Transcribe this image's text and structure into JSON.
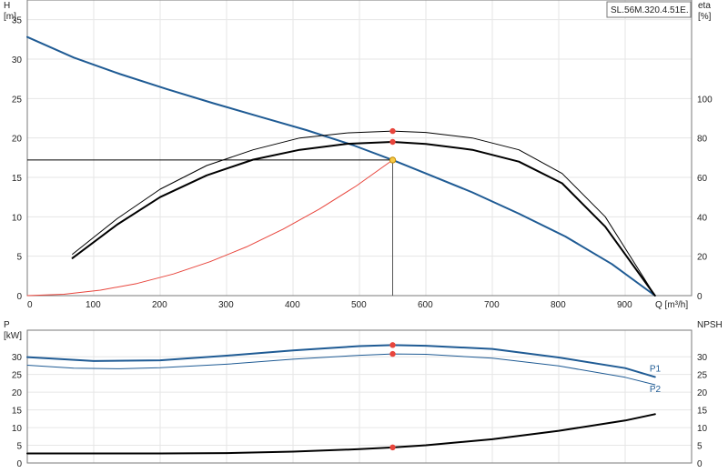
{
  "colors": {
    "head": "#1f5b94",
    "eta": "#000000",
    "power": "#1f5b94",
    "npsh": "#000000",
    "system": "#e8453c",
    "marker": "#e8453c",
    "op_marker": "#f7c948",
    "grid": "#e6e6e6"
  },
  "chart_data": [
    {
      "type": "line",
      "title": "SL.56M.320.4.51E.",
      "xlabel": "Q [m³/h]",
      "ylabel_left": "H\n[m]",
      "ylabel_right": "eta\n[%]",
      "xlim": [
        0,
        1000
      ],
      "x_ticks": [
        0,
        100,
        200,
        300,
        400,
        500,
        600,
        700,
        800,
        900
      ],
      "ylim_left": [
        0,
        37.5
      ],
      "y_ticks_left": [
        0,
        5,
        10,
        15,
        20,
        25,
        30,
        35
      ],
      "ylim_right": [
        0,
        150
      ],
      "y_ticks_right": [
        0,
        20,
        40,
        60,
        80,
        100
      ],
      "grid": true,
      "series": [
        {
          "key": "head",
          "axis": "left",
          "width": 2,
          "x": [
            0,
            70,
            140,
            210,
            280,
            350,
            420,
            490,
            550,
            600,
            670,
            740,
            810,
            880,
            945
          ],
          "y": [
            32.8,
            30.2,
            28.1,
            26.2,
            24.4,
            22.7,
            21.0,
            19.1,
            17.2,
            15.5,
            13.1,
            10.4,
            7.5,
            4.0,
            0.0
          ]
        },
        {
          "key": "eta",
          "axis": "right",
          "width": 2,
          "x": [
            68,
            135,
            200,
            270,
            340,
            410,
            480,
            550,
            600,
            670,
            740,
            805,
            870,
            945
          ],
          "y": [
            19,
            36,
            50,
            61,
            69,
            74,
            77,
            78,
            77,
            74,
            68,
            57,
            35,
            0
          ]
        },
        {
          "key": "eta",
          "axis": "right",
          "width": 1,
          "x": [
            68,
            135,
            200,
            270,
            340,
            410,
            480,
            550,
            600,
            670,
            740,
            805,
            870,
            945
          ],
          "y": [
            21,
            39,
            54,
            66,
            74,
            80,
            82.5,
            83.5,
            82.8,
            80,
            74,
            62,
            40,
            0
          ]
        },
        {
          "key": "system",
          "axis": "left",
          "width": 1,
          "x": [
            0,
            55,
            110,
            165,
            220,
            275,
            330,
            385,
            440,
            495,
            550
          ],
          "y": [
            0,
            0.17,
            0.69,
            1.54,
            2.75,
            4.3,
            6.19,
            8.43,
            11.0,
            13.9,
            17.2
          ]
        }
      ],
      "markers": [
        {
          "x": 550,
          "y": 83.5,
          "axis": "right",
          "key": "marker"
        },
        {
          "x": 550,
          "y": 78,
          "axis": "right",
          "key": "marker"
        },
        {
          "x": 550,
          "y": 17.2,
          "axis": "left",
          "key": "op_marker"
        }
      ],
      "duty_point": {
        "x": 550,
        "y": 17.2
      }
    },
    {
      "type": "line",
      "xlabel": "",
      "ylabel_left": "P\n[kW]",
      "ylabel_right": "NPSH\n[m]",
      "xlim": [
        0,
        1000
      ],
      "x_ticks": [
        0,
        100,
        200,
        300,
        400,
        500,
        600,
        700,
        800,
        900
      ],
      "ylim_left": [
        0,
        37.5
      ],
      "y_ticks_left": [
        0,
        5,
        10,
        15,
        20,
        25,
        30
      ],
      "ylim_right": [
        0,
        37.5
      ],
      "y_ticks_right": [
        0,
        5,
        10,
        15,
        20,
        25,
        30
      ],
      "grid": true,
      "series": [
        {
          "name": "P1",
          "key": "power",
          "axis": "left",
          "width": 2,
          "x": [
            0,
            100,
            200,
            300,
            400,
            500,
            550,
            600,
            700,
            800,
            900,
            945
          ],
          "y": [
            29.9,
            28.8,
            29.0,
            30.3,
            31.8,
            33.0,
            33.3,
            33.1,
            32.2,
            29.8,
            26.8,
            24.3
          ]
        },
        {
          "name": "P2",
          "key": "power",
          "axis": "left",
          "width": 1,
          "x": [
            0,
            70,
            140,
            200,
            300,
            400,
            500,
            550,
            600,
            700,
            800,
            900,
            945
          ],
          "y": [
            27.6,
            26.8,
            26.6,
            26.9,
            27.9,
            29.3,
            30.4,
            30.8,
            30.7,
            29.6,
            27.4,
            24.2,
            22.1
          ]
        },
        {
          "key": "npsh",
          "axis": "right",
          "width": 2,
          "x": [
            0,
            100,
            200,
            300,
            400,
            500,
            550,
            600,
            700,
            800,
            900,
            945
          ],
          "y": [
            2.7,
            2.7,
            2.7,
            2.8,
            3.2,
            3.9,
            4.4,
            5.0,
            6.7,
            9.1,
            12.0,
            13.8
          ]
        }
      ],
      "markers": [
        {
          "x": 550,
          "y": 33.3,
          "axis": "left",
          "key": "marker"
        },
        {
          "x": 550,
          "y": 30.8,
          "axis": "left",
          "key": "marker"
        },
        {
          "x": 550,
          "y": 4.4,
          "axis": "right",
          "key": "marker"
        }
      ]
    }
  ]
}
